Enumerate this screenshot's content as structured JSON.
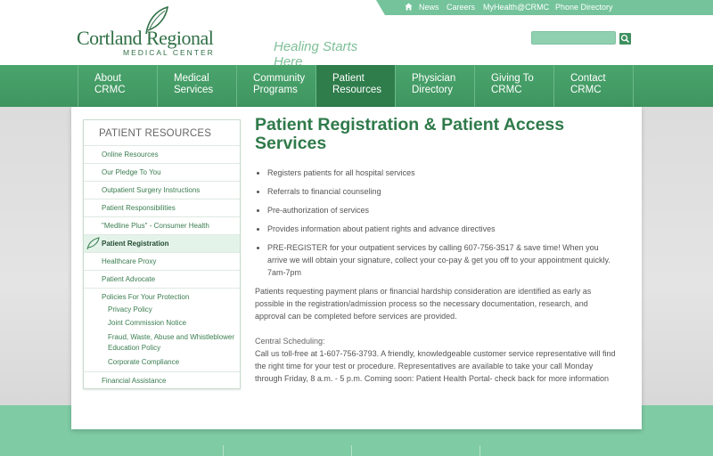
{
  "top_links": {
    "news": "News",
    "careers": "Careers",
    "myhealth": "MyHealth@CRMC",
    "phone_directory": "Phone Directory"
  },
  "logo": {
    "name": "Cortland Regional",
    "subtitle": "MEDICAL CENTER"
  },
  "tagline": "Healing Starts Here",
  "search": {
    "placeholder": ""
  },
  "nav": [
    {
      "line1": "About",
      "line2": "CRMC"
    },
    {
      "line1": "Medical",
      "line2": "Services"
    },
    {
      "line1": "Community",
      "line2": "Programs"
    },
    {
      "line1": "Patient",
      "line2": "Resources"
    },
    {
      "line1": "Physician",
      "line2": "Directory"
    },
    {
      "line1": "Giving To",
      "line2": "CRMC"
    },
    {
      "line1": "Contact",
      "line2": "CRMC"
    }
  ],
  "sidebar": {
    "title": "PATIENT RESOURCES",
    "items": [
      "Online Resources",
      "Our Pledge To You",
      "Outpatient Surgery Instructions",
      "Patient Responsibilities",
      "\"Medline Plus\" - Consumer Health",
      "Patient Registration",
      "Healthcare Proxy",
      "Patient Advocate",
      "Policies For Your Protection"
    ],
    "subitems": [
      "Privacy Policy",
      "Joint Commission Notice",
      "Fraud, Waste, Abuse and Whistleblower",
      "Education Policy",
      "Corporate Compliance"
    ],
    "last_item": "Financial Assistance"
  },
  "main": {
    "title": "Patient Registration & Patient Access Services",
    "bullets": [
      "Registers patients for all hospital services",
      "Referrals to financial counseling",
      "Pre-authorization of services",
      "Provides information about patient rights and advance directives",
      "PRE-REGISTER for your outpatient services by calling 607-756-3517 & save time! When you arrive we will obtain your signature, collect your co-pay & get you off to your appointment quickly. 7am-7pm"
    ],
    "para1": "Patients requesting payment plans or financial hardship consideration are identified as early as possible in the registration/admission process so the necessary documentation, research, and approval can be completed before services are provided.",
    "scheduling_label": "Central Scheduling:",
    "scheduling_text": "Call us toll-free at 1-607-756-3793.  A friendly, knowledgeable customer service representative will find the right time for your test or procedure. Representatives are available to take your call Monday through Friday, 8 a.m. - 5 p.m.  Coming soon: Patient Health Portal- check back for more information"
  },
  "colors": {
    "brand_green": "#2f7a4a",
    "nav_green": "#4aa46c",
    "active_nav": "#2e7d4b",
    "footer_green": "#7ecba4"
  },
  "icons": {
    "home": "home-icon",
    "search": "search-icon",
    "logo_leaf": "leaf-icon"
  }
}
